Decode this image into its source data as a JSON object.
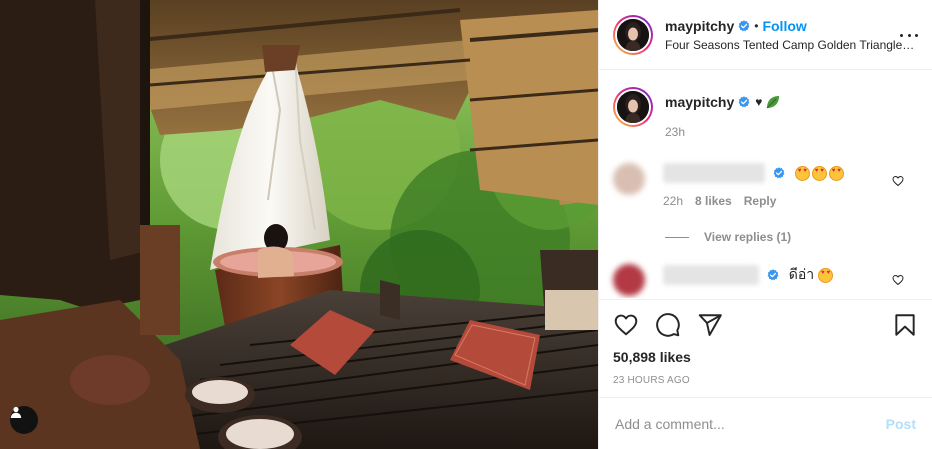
{
  "post": {
    "author": {
      "username": "maypitchy",
      "verified_icon": "verified-badge",
      "follow_label": "Follow",
      "separator": "•",
      "location": "Four Seasons Tented Camp Golden Triangle, Thailand"
    },
    "caption": {
      "username": "maypitchy",
      "text": "♥",
      "leaf_icon": "leaf-emoji",
      "time": "23h"
    },
    "comments": [
      {
        "text": "",
        "emojis": [
          "star-struck",
          "star-struck",
          "star-struck"
        ],
        "time": "22h",
        "likes": "8 likes",
        "reply_label": "Reply",
        "view_replies": "View replies (1)"
      },
      {
        "text": "ดีอ่า",
        "emojis": [
          "star-struck"
        ]
      }
    ],
    "actions": {
      "like_icon": "heart-icon",
      "comment_icon": "comment-icon",
      "share_icon": "paper-plane-icon",
      "save_icon": "bookmark-icon"
    },
    "likes_count": "50,898 likes",
    "age": "23 HOURS AGO",
    "add_comment": {
      "placeholder": "Add a comment...",
      "post_label": "Post"
    },
    "colors": {
      "accent": "#0095f6",
      "post_disabled": "#b2dffc",
      "muted": "#8e8e8e",
      "text": "#262626"
    }
  }
}
